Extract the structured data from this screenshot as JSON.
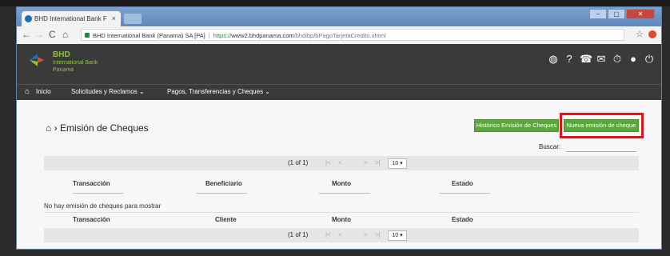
{
  "browser": {
    "tab_title": "BHD International Bank F",
    "tab_close": "×",
    "window_controls": [
      "–",
      "▢",
      "✕"
    ],
    "nav": {
      "back": "←",
      "forward": "→",
      "reload": "C",
      "home": "⌂"
    },
    "url_site": "BHD International Bank (Panama) SA [PA]",
    "url_separator": "|",
    "url_scheme": "https://",
    "url_host": "www2.bhdpanama.com",
    "url_path": "/bhdibp/bPagoTarjetaCredito.xhtml",
    "star": "☆"
  },
  "header": {
    "brand_line1": "BHD",
    "brand_line2": "International Bank",
    "brand_line3": "Panama",
    "icons": [
      "globe-icon",
      "help-icon",
      "phone-icon",
      "mail-icon",
      "timer-icon",
      "user-icon",
      "power-icon"
    ],
    "icon_glyphs": [
      "◍",
      "?",
      "☎",
      "✉",
      "⏱",
      "●",
      "⏻"
    ],
    "logo_colors": [
      "#1e6db4",
      "#8fc53e",
      "#e04a2f"
    ]
  },
  "nav": {
    "home_glyph": "⌂",
    "items": [
      "Inicio",
      "Solicitudes y Reclamos ⌄",
      "Pagos, Transferencias y Cheques ⌄"
    ]
  },
  "page": {
    "breadcrumb_glyph": "⌂",
    "breadcrumb_arrow": "›",
    "title": "Emisión de Cheques",
    "historic_button": "Histórico Emisión de Cheques",
    "new_button": "Nueva emisión de cheque",
    "search_label": "Buscar:",
    "search_value": ""
  },
  "paginator": {
    "text": "(1 of 1)",
    "first": "|<",
    "prev": "<",
    "next": ">",
    "last": ">|",
    "rows_per_page": "10 ▾"
  },
  "table1": {
    "headers": [
      "Transacción",
      "Beneficiario",
      "Monto",
      "Estado"
    ]
  },
  "empty_message": "No hay emisión de cheques para mostrar",
  "table2": {
    "headers": [
      "Transacción",
      "Cliente",
      "Monto",
      "Estado"
    ]
  },
  "colors": {
    "accent_green": "#5aa83a",
    "highlight_red": "#e3131b",
    "header_dark": "#3a3a3a",
    "brand_green": "#8fc53e"
  }
}
